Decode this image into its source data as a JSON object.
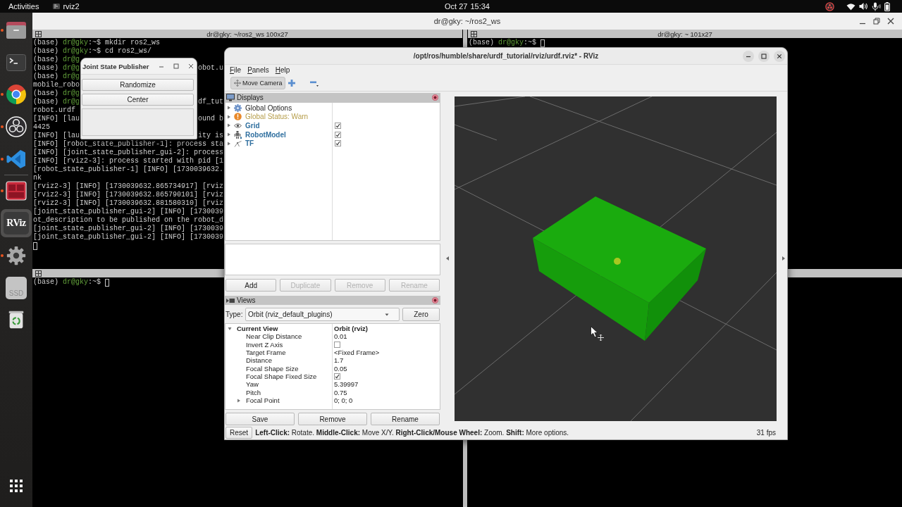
{
  "top_bar": {
    "activities": "Activities",
    "app_name": "rviz2",
    "date": "Oct 27",
    "time": "15:34"
  },
  "dock": {
    "groups": [
      [
        {
          "kind": "folder",
          "running": true,
          "selected": false
        },
        {
          "kind": "terminal",
          "running": false,
          "selected": false
        },
        {
          "kind": "browser",
          "running": true,
          "selected": false
        },
        {
          "kind": "recorder",
          "running": true,
          "selected": false
        },
        {
          "kind": "editor",
          "running": true,
          "selected": false
        }
      ],
      [
        {
          "kind": "split_terminal",
          "running": true,
          "selected": false
        },
        {
          "kind": "rviz",
          "label": "RViz",
          "running": false,
          "selected": true
        },
        {
          "kind": "settings",
          "running": true,
          "selected": false
        },
        {
          "kind": "drive",
          "label": "SSD",
          "running": false,
          "selected": false
        },
        {
          "kind": "trash",
          "running": false,
          "selected": false
        }
      ]
    ]
  },
  "terminal_window": {
    "title": "dr@gky: ~/ros2_ws",
    "panes": [
      {
        "title": "dr@gky: ~/ros2_ws 100x27",
        "lines": [
          {
            "kind": "prompt",
            "env": "(base)",
            "user": "dr@gky",
            "rest": ":~$ mkdir ros2_ws"
          },
          {
            "kind": "prompt",
            "env": "(base)",
            "user": "dr@gky",
            "rest": ":~$ cd ros2_ws/"
          },
          {
            "kind": "prompt",
            "env": "(base)",
            "user": "dr@g"
          },
          {
            "kind": "prompt",
            "env": "(base)",
            "user": "dr@g",
            "tail": "obot.u"
          },
          {
            "kind": "prompt",
            "env": "(base)",
            "user": "dr@g"
          },
          {
            "kind": "output",
            "text": "mobile_robo"
          },
          {
            "kind": "prompt",
            "env": "(base)",
            "user": "dr@g"
          },
          {
            "kind": "prompt",
            "env": "(base)",
            "user": "dr@g",
            "tail": "df_tut"
          },
          {
            "kind": "output",
            "text": "robot.urdf"
          },
          {
            "kind": "output",
            "text": "[INFO] [lau",
            "tail": "ound b"
          },
          {
            "kind": "output",
            "text": "4425"
          },
          {
            "kind": "output",
            "text": "[INFO] [lau",
            "tail": "ity is"
          },
          {
            "kind": "output",
            "text": "[INFO] [robot_state_publisher-1]: process sta"
          },
          {
            "kind": "output",
            "text": "[INFO] [joint_state_publisher_gui-2]: process"
          },
          {
            "kind": "output",
            "text": "[INFO] [rviz2-3]: process started with pid [1"
          },
          {
            "kind": "output",
            "text": "[robot_state_publisher-1] [INFO] [1730039632."
          },
          {
            "kind": "output",
            "text": "nk"
          },
          {
            "kind": "output",
            "text": "[rviz2-3] [INFO] [1730039632.865734917] [rviz"
          },
          {
            "kind": "output",
            "text": "[rviz2-3] [INFO] [1730039632.865790101] [rviz"
          },
          {
            "kind": "output",
            "text": "[rviz2-3] [INFO] [1730039632.881580310] [rviz"
          },
          {
            "kind": "output",
            "text": "[joint_state_publisher_gui-2] [INFO] [1730039"
          },
          {
            "kind": "output",
            "text": "ot_description to be published on the robot_d"
          },
          {
            "kind": "output",
            "text": "[joint_state_publisher_gui-2] [INFO] [1730039"
          },
          {
            "kind": "output",
            "text": "[joint_state_publisher_gui-2] [INFO] [1730039"
          },
          {
            "kind": "cursor"
          }
        ]
      },
      {
        "title": "dr@gky: ~ 101x27",
        "lines": [
          {
            "kind": "prompt",
            "env": "(base)",
            "user": "dr@gky",
            "rest": ":~$",
            "cursor": true
          }
        ]
      },
      {
        "lines": [
          {
            "kind": "prompt",
            "env": "(base)",
            "user": "dr@gky",
            "rest": ":~$",
            "cursor": true
          }
        ]
      }
    ]
  },
  "joint_state_publisher": {
    "title": "Joint State Publisher",
    "buttons": [
      "Randomize",
      "Center"
    ]
  },
  "rviz_window": {
    "title": "/opt/ros/humble/share/urdf_tutorial/rviz/urdf.rviz* - RViz",
    "menu": [
      "File",
      "Panels",
      "Help"
    ],
    "tools": [
      {
        "label": "Move Camera",
        "selected": true
      }
    ],
    "displays_panel": {
      "title": "Displays",
      "items": [
        {
          "kind": "options",
          "label": "Global Options",
          "expanded": false
        },
        {
          "kind": "status",
          "label": "Global Status: Warn",
          "expanded": false
        },
        {
          "kind": "grid",
          "label": "Grid",
          "expanded": false,
          "checked": true
        },
        {
          "kind": "robot_model",
          "label": "RobotModel",
          "expanded": false,
          "checked": true
        },
        {
          "kind": "tf",
          "label": "TF",
          "expanded": false,
          "checked": true
        }
      ],
      "buttons": [
        {
          "label": "Add",
          "disabled": false
        },
        {
          "label": "Duplicate",
          "disabled": true
        },
        {
          "label": "Remove",
          "disabled": true
        },
        {
          "label": "Rename",
          "disabled": true
        }
      ]
    },
    "views_panel": {
      "title": "Views",
      "type_label": "Type:",
      "type_value": "Orbit (rviz_default_plugins)",
      "zero_button": "Zero",
      "properties": [
        {
          "kind": "group",
          "name": "Current View",
          "value": "Orbit (rviz)",
          "expanded": true,
          "children": [
            {
              "kind": "value",
              "name": "Near Clip Distance",
              "value": "0.01"
            },
            {
              "kind": "checkbox",
              "name": "Invert Z Axis",
              "checked": false
            },
            {
              "kind": "value",
              "name": "Target Frame",
              "value": "<Fixed Frame>"
            },
            {
              "kind": "value",
              "name": "Distance",
              "value": "1.7"
            },
            {
              "kind": "value",
              "name": "Focal Shape Size",
              "value": "0.05"
            },
            {
              "kind": "checkbox",
              "name": "Focal Shape Fixed Size",
              "checked": true
            },
            {
              "kind": "value",
              "name": "Yaw",
              "value": "5.39997"
            },
            {
              "kind": "value",
              "name": "Pitch",
              "value": "0.75"
            },
            {
              "kind": "group",
              "name": "Focal Point",
              "value": "0; 0; 0",
              "expanded": false
            }
          ]
        }
      ],
      "buttons": [
        "Save",
        "Remove",
        "Rename"
      ]
    },
    "status_bar": {
      "reset_button": "Reset",
      "hint": "**Left-Click:** Rotate. **Middle-Click:** Move X/Y. **Right-Click/Mouse Wheel:** Zoom. **Shift:** More options.",
      "fps": "31 fps"
    }
  }
}
